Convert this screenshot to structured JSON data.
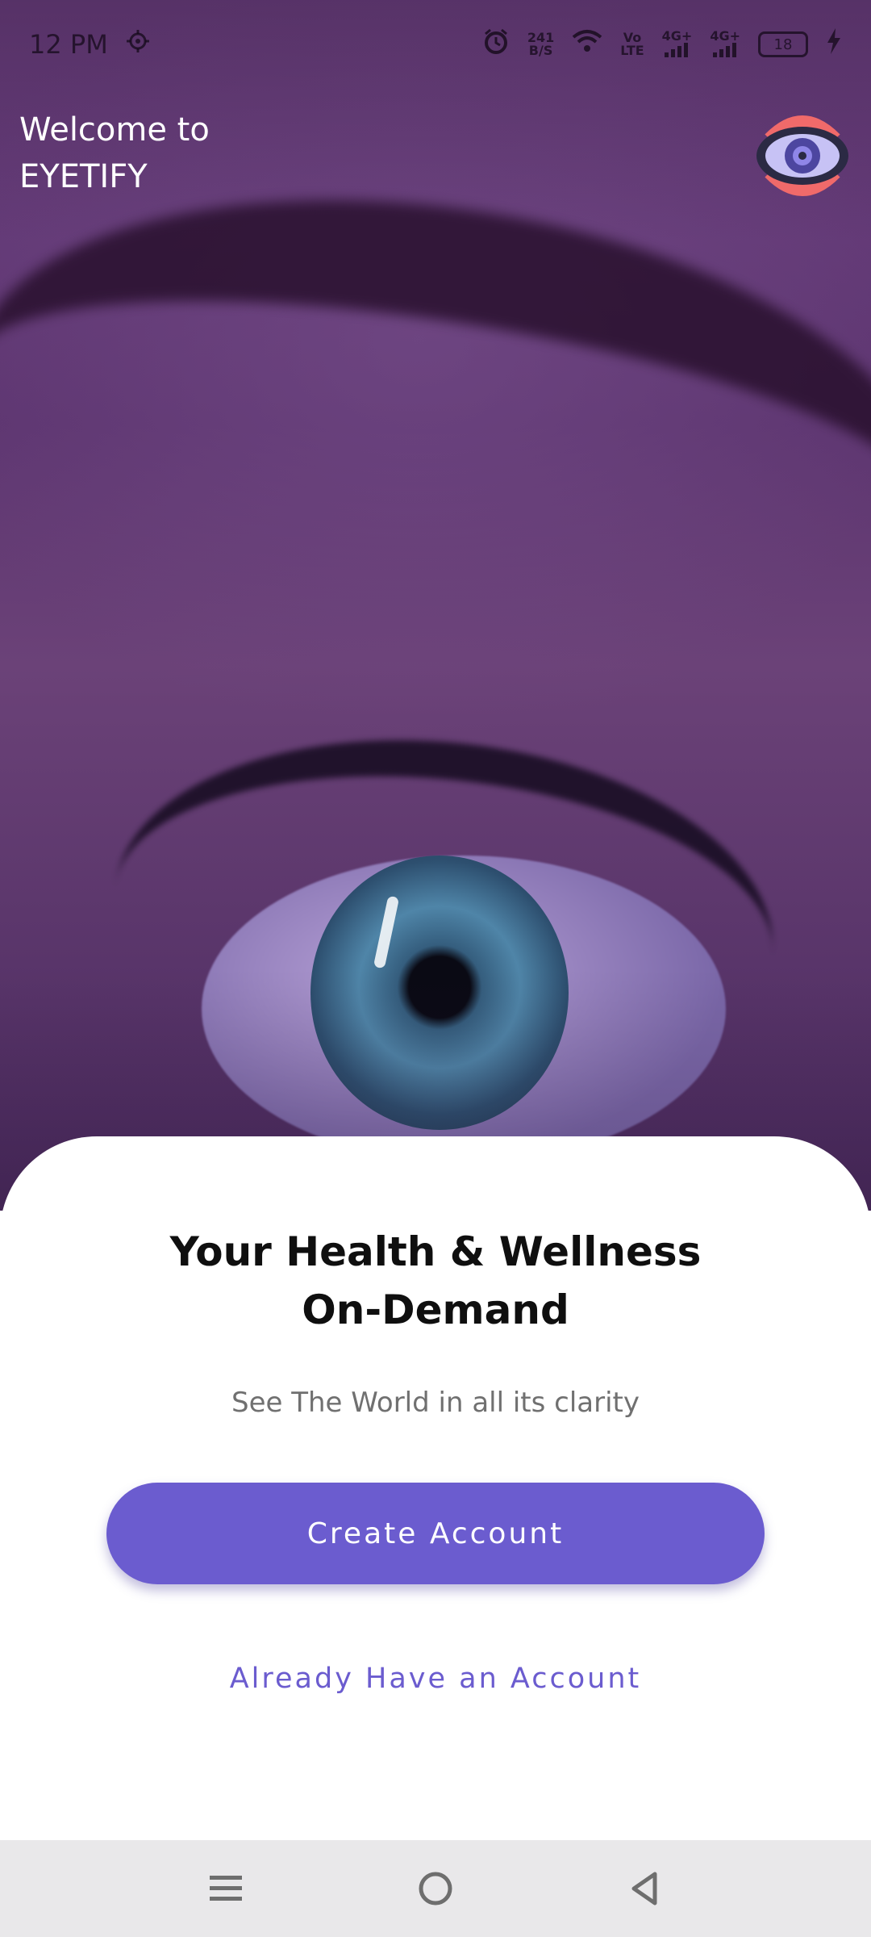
{
  "status_bar": {
    "time": "12 PM",
    "data_speed_value": "241",
    "data_speed_unit": "B/S",
    "volte_top": "Vo",
    "volte_bottom": "LTE",
    "network_1": "4G+",
    "network_2": "4G+",
    "battery_level": "18",
    "icons": [
      "settings-icon",
      "alarm-icon",
      "wifi-icon",
      "signal-icon",
      "battery-icon",
      "charging-icon"
    ]
  },
  "header": {
    "welcome_line1": "Welcome to",
    "welcome_line2": "EYETIFY",
    "logo_icon": "eye-logo-icon"
  },
  "sheet": {
    "headline_line1": "Your Health & Wellness",
    "headline_line2": "On-Demand",
    "subtitle": "See The World in all its clarity",
    "create_account_label": "Create Account",
    "login_label": "Already Have an Account"
  },
  "nav_bar": {
    "icons": [
      "menu-icon",
      "home-icon",
      "back-icon"
    ]
  },
  "colors": {
    "accent": "#6b5ccf",
    "logo_ring": "#f06a6a",
    "logo_eye": "#2b2a44"
  }
}
